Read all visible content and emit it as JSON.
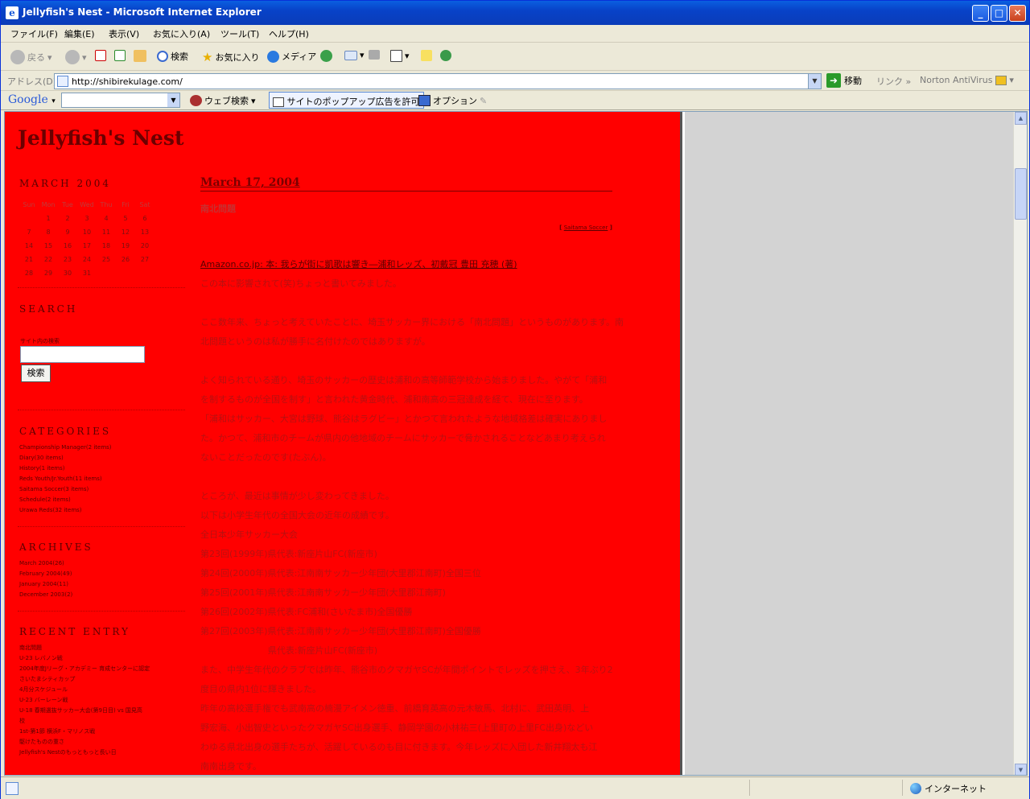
{
  "window": {
    "title": "Jellyfish's Nest - Microsoft Internet Explorer",
    "ie_glyph": "e"
  },
  "menu": [
    "ファイル(F)",
    "編集(E)",
    "表示(V)",
    "お気に入り(A)",
    "ツール(T)",
    "ヘルプ(H)"
  ],
  "toolbar": {
    "back": "戻る",
    "search": "検索",
    "favorites": "お気に入り",
    "media": "メディア"
  },
  "address": {
    "label": "アドレス(D)",
    "url": "http://shibirekulage.com/",
    "go": "移動",
    "links": "リンク",
    "norton": "Norton AntiVirus",
    "chevron": "»"
  },
  "google": {
    "logo": "Google",
    "web_search": "ウェブ検索",
    "popup": "サイトのポップアップ広告を許可",
    "options": "オプション"
  },
  "site": {
    "title": "Jellyfish's Nest"
  },
  "calendar": {
    "heading": "MARCH 2004",
    "weekdays": [
      "Sun",
      "Mon",
      "Tue",
      "Wed",
      "Thu",
      "Fri",
      "Sat"
    ],
    "weeks": [
      [
        "",
        "1",
        "2",
        "3",
        "4",
        "5",
        "6"
      ],
      [
        "7",
        "8",
        "9",
        "10",
        "11",
        "12",
        "13"
      ],
      [
        "14",
        "15",
        "16",
        "17",
        "18",
        "19",
        "20"
      ],
      [
        "21",
        "22",
        "23",
        "24",
        "25",
        "26",
        "27"
      ],
      [
        "28",
        "29",
        "30",
        "31",
        "",
        "",
        ""
      ]
    ]
  },
  "search": {
    "heading": "SEARCH",
    "label": "サイト内の検索",
    "button": "検索"
  },
  "categories": {
    "heading": "CATEGORIES",
    "items": [
      "Championship Manager(2 items)",
      "Diary(30 items)",
      "History(1 items)",
      "Reds Youth/Jr.Youth(11 items)",
      "Saitama Soccer(3 items)",
      "Schedule(2 items)",
      "Urawa Reds(32 items)"
    ]
  },
  "archives": {
    "heading": "ARCHIVES",
    "items": [
      "March 2004(26)",
      "February 2004(49)",
      "January 2004(11)",
      "December 2003(2)"
    ]
  },
  "recent": {
    "heading": "RECENT ENTRY",
    "items": [
      "南北問題",
      "U-23 レバノン戦",
      "2004年度Jリーグ・アカデミー 育成センターに認定",
      "さいたまシティカップ",
      "4月分スケジュール",
      "U-23 バーレーン戦",
      "U-18 春期選抜サッカー大会(第9日目) vs 国見高",
      "校",
      "1st-第1節 横浜F・マリノス戦",
      "駆けたものの重さ",
      "Jellyfish's Nestのもっともっと長い日"
    ]
  },
  "post": {
    "date": "March 17, 2004",
    "title": "南北問題",
    "category_open": "[ ",
    "category": "Saitama Soccer",
    "category_close": " ]",
    "amazon": "Amazon.co.jp: 本: 我らが街に凱歌は響き―浦和レッズ、初戴冠 豊田 充穂 (著)",
    "lines": [
      "この本に影響されて(笑)ちょっと書いてみました。",
      "",
      "ここ数年来、ちょっと考えていたことに、埼玉サッカー界における「南北問題」というものがあります。南",
      "北問題というのは私が勝手に名付けたのではありますが。",
      "",
      "よく知られている通り、埼玉のサッカーの歴史は浦和の高等師範学校から始まりました。やがて「浦和",
      "を制するものが全国を制す」と言われた黄金時代、浦和南高の三冠達成を経て、現在に至ります。",
      "「浦和はサッカー、大宮は野球、熊谷はラグビー」とかつて言われたような地域格差は確実にありまし",
      "た。かつて、浦和市のチームが県内の他地域のチームにサッカーで脅かされることなどあまり考えられ",
      "ないことだったのです(たぶん)。",
      "",
      "ところが、最近は事情が少し変わってきました。",
      "以下は小学生年代の全国大会の近年の成績です。",
      "全日本少年サッカー大会",
      "第23回(1999年)県代表:新座片山FC(新座市)",
      "第24回(2000年)県代表:江南南サッカー少年団(大里郡江南町)全国三位",
      "第25回(2001年)県代表:江南南サッカー少年団(大里郡江南町)",
      "第26回(2002年)県代表:FC浦和(さいたま市)全国優勝",
      "第27回(2003年)県代表:江南南サッカー少年団(大里郡江南町)全国優勝",
      "                        県代表:新座片山FC(新座市)",
      "また、中学生年代のクラブでは昨年、熊谷市のクマガヤSCが年間ポイントでレッズを押さえ、3年ぶり2",
      "度目の県内1位に輝きました。",
      "昨年の高校選手権でも武南高の楠漫アイメン徳重、前橋育英高の元木敏馬、北村に、武田英明、上",
      "野宏海、小出智史といったクマガヤSC出身選手、静岡学園の小林祐三(上里町の上里FC出身)などい",
      "わゆる県北出身の選手たちが、活躍しているのも目に付きます。今年レッズに入団した新井翔太も江",
      "南南出身です。",
      "今や、特に4種(小学生年代)、3種(中学生年代)においては県北勢は県内でも有数の強豪で安心しま"
    ]
  },
  "status": {
    "zone": "インターネット"
  }
}
